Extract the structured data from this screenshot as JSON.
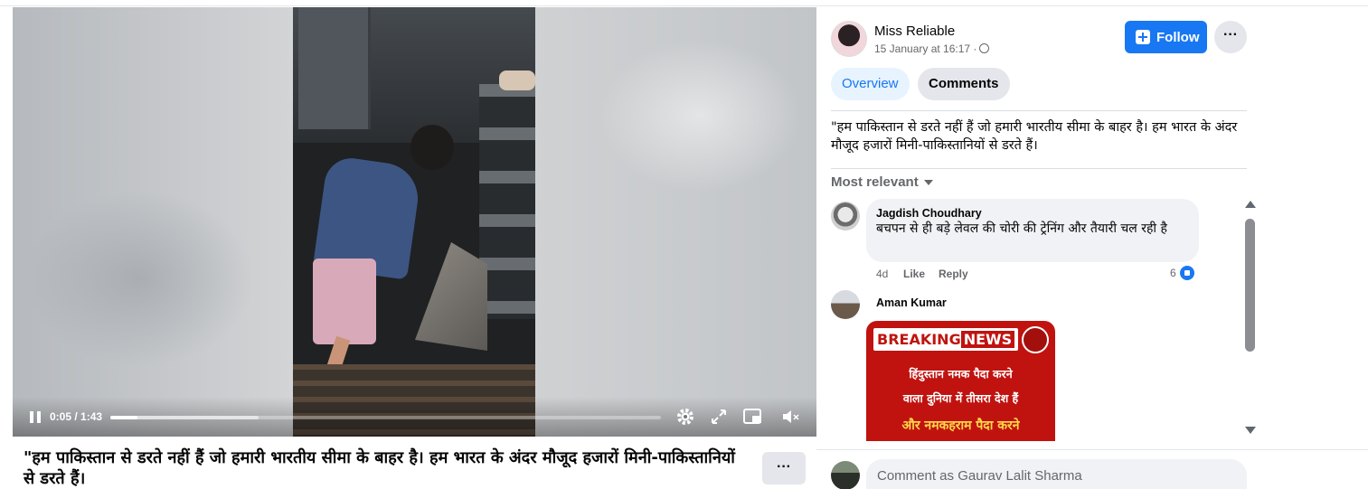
{
  "video": {
    "time": "0:05 / 1:43",
    "played_fraction": 0.05,
    "buffered_fraction": 0.27
  },
  "caption": "\"हम पाकिस्तान से डरते नहीं हैं जो हमारी भारतीय सीमा के बाहर है। हम भारत के अंदर मौजूद हजारों मिनी-पाकिस्तानियों से डरते हैं।",
  "more_button": "···",
  "post": {
    "author": "Miss Reliable",
    "time": "15 January at 16:17 ·",
    "follow_label": "Follow",
    "dots": "···",
    "text": "\"हम पाकिस्तान से डरते नहीं हैं जो हमारी भारतीय सीमा के बाहर है। हम भारत के अंदर मौजूद हजारों मिनी-पाकिस्तानियों से डरते हैं।"
  },
  "tabs": {
    "overview": "Overview",
    "comments": "Comments"
  },
  "sort_label": "Most relevant",
  "comments": [
    {
      "name": "Jagdish Choudhary",
      "text": "बचपन से ही बड़े लेवल की चोरी की ट्रेनिंग और तैयारी चल रही है",
      "age": "4d",
      "like": "Like",
      "reply": "Reply",
      "reactions": "6"
    },
    {
      "name": "Aman Kumar",
      "image": {
        "headline_a": "BREAKING",
        "headline_b": "NEWS",
        "line1": "हिंदुस्तान नमक पैदा करने",
        "line2": "वाला दुनिया में तीसरा देश हैं",
        "line3": "और नमकहराम पैदा करने"
      }
    }
  ],
  "comment_box": {
    "placeholder": "Comment as Gaurav Lalit Sharma"
  },
  "colors": {
    "accent": "#1877f2",
    "breaking_red": "#c0130f"
  },
  "icons": [
    "pause-icon",
    "settings-gear-icon",
    "fullscreen-icon",
    "picture-in-picture-icon",
    "muted-speaker-icon",
    "globe-icon",
    "plus-icon",
    "caret-down-icon",
    "like-reaction-icon",
    "scroll-up-icon",
    "scroll-down-icon"
  ]
}
